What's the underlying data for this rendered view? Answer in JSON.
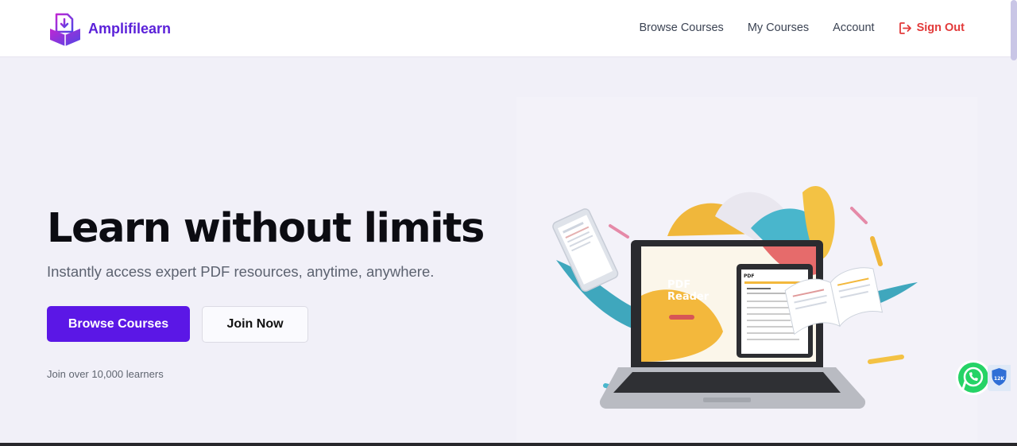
{
  "brand": {
    "name": "Amplifilearn",
    "logo_icon": "book-download-icon"
  },
  "nav": {
    "browse": "Browse Courses",
    "my_courses": "My Courses",
    "account": "Account",
    "sign_out": "Sign Out",
    "sign_out_icon": "logout-icon"
  },
  "hero": {
    "title": "Learn without limits",
    "subtitle": "Instantly access expert PDF resources, anytime, anywhere.",
    "primary_cta": "Browse Courses",
    "secondary_cta": "Join Now",
    "learners_text": "Join over 10,000 learners"
  },
  "illustration": {
    "screen_title_line1": "PDF",
    "screen_title_line2": "Reader",
    "tablet_logo": "PDF"
  },
  "floating": {
    "whatsapp_icon": "whatsapp-icon",
    "badge_text": "12K",
    "badge_icon": "shield-badge-icon"
  },
  "colors": {
    "accent": "#5b17e6",
    "brand": "#5b21d9",
    "danger": "#e23a3a",
    "background": "#f1f0f8"
  }
}
